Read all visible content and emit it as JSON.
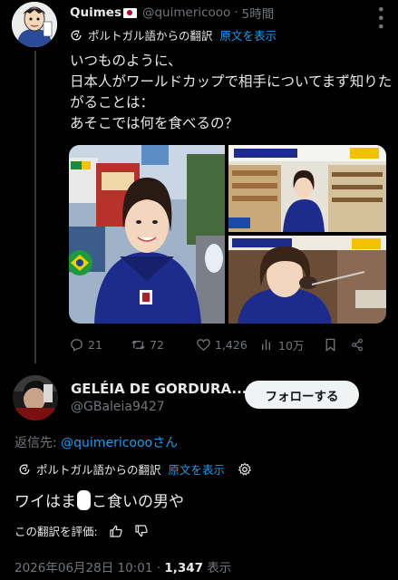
{
  "tweet": {
    "author_name": "Quimes",
    "author_handle": "@quimericooo",
    "separator": "·",
    "time": "5時間",
    "translation": {
      "label": "ポルトガル語からの翻訳",
      "show_original": "原文を表示"
    },
    "text": "いつものように、\n日本人がワールドカップで相手についてまず知りたがることは：\nあそこでは何を食べるの？",
    "stats": {
      "replies": "21",
      "retweets": "72",
      "likes": "1,426",
      "views": "10万"
    }
  },
  "reply": {
    "author_name": "GELÉIA DE GORDURA...",
    "author_handle": "@GBaleia9427",
    "follow_label": "フォローする",
    "reply_to_prefix": "返信先: ",
    "reply_to_mention": "@quimericooo",
    "reply_to_suffix": "さん",
    "translation": {
      "label": "ポルトガル語からの翻訳",
      "show_original": "原文を表示"
    },
    "text_before": "ワイはま",
    "text_after": "こ食いの男や",
    "rate_label": "この翻訳を評価:",
    "date": "2026年06月28日 10:01",
    "meta_separator": "·",
    "views_count": "1,347",
    "views_label": "表示"
  },
  "colors": {
    "background": "#000000",
    "text": "#e7e9ea",
    "muted": "#71767b",
    "link": "#1d9bf0"
  }
}
